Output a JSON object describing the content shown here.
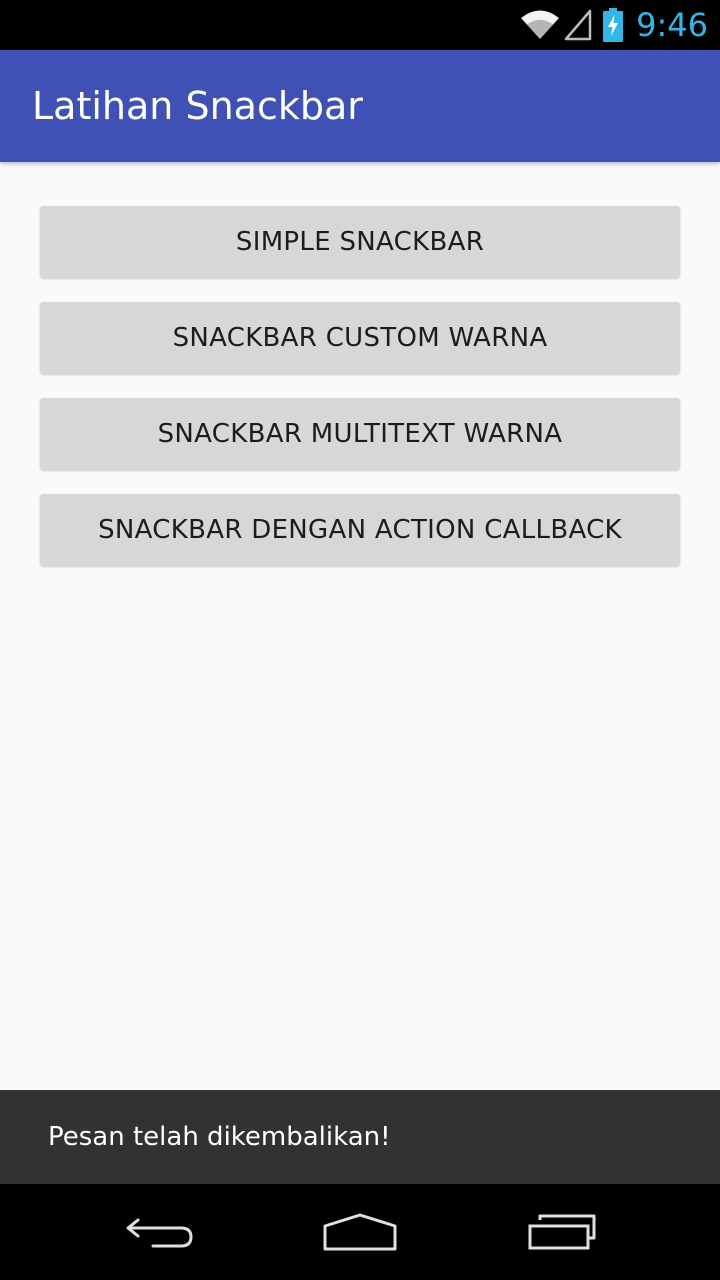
{
  "status_bar": {
    "time": "9:46",
    "icons": [
      "wifi-icon",
      "signal-icon",
      "battery-charging-icon"
    ],
    "clock_color": "#33b5e5"
  },
  "app_bar": {
    "title": "Latihan Snackbar",
    "color": "#3f51b5"
  },
  "buttons": [
    {
      "label": "SIMPLE SNACKBAR"
    },
    {
      "label": "SNACKBAR CUSTOM WARNA"
    },
    {
      "label": "SNACKBAR MULTITEXT WARNA"
    },
    {
      "label": "SNACKBAR DENGAN ACTION CALLBACK"
    }
  ],
  "snackbar": {
    "message": "Pesan telah dikembalikan!",
    "color": "#323232"
  },
  "nav_bar": {
    "icons": [
      "back-icon",
      "home-icon",
      "recents-icon"
    ]
  }
}
